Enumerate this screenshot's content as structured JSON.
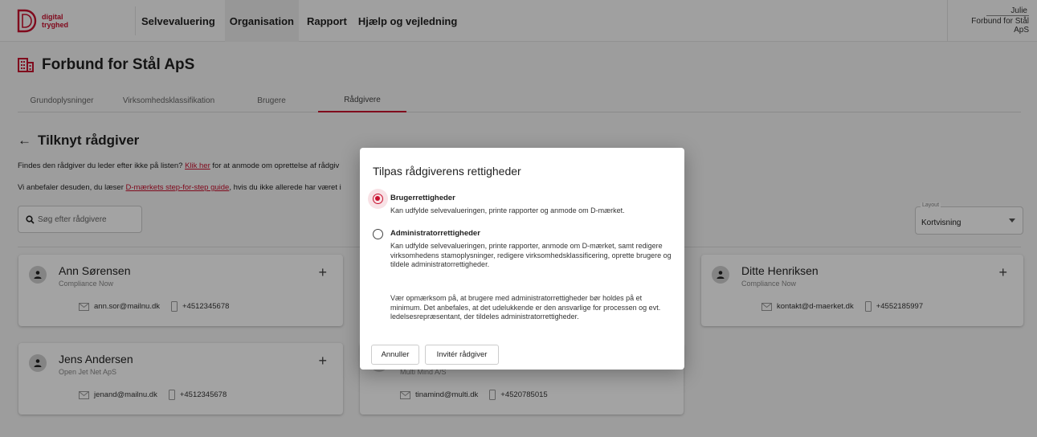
{
  "brand": {
    "line1": "digital",
    "line2": "tryghed",
    "color": "#c8102e"
  },
  "nav": {
    "items": [
      {
        "label": "Selvevaluering"
      },
      {
        "label": "Organisation"
      },
      {
        "label": "Rapport"
      },
      {
        "label": "Hjælp og vejledning"
      }
    ]
  },
  "user": {
    "name": "Julie",
    "org_line1": "Forbund for Stål",
    "org_line2": "ApS"
  },
  "org": {
    "title": "Forbund for Stål ApS"
  },
  "tabs": [
    {
      "label": "Grundoplysninger"
    },
    {
      "label": "Virksomhedsklassifikation"
    },
    {
      "label": "Brugere"
    },
    {
      "label": "Rådgivere"
    }
  ],
  "section": {
    "back_arrow": "←",
    "title": "Tilknyt rådgiver",
    "info1_pre": "Findes den rådgiver du leder efter ikke på listen? ",
    "info1_link": "Klik her",
    "info1_post": " for at anmode om oprettelse af rådgiv",
    "info2_pre": "Vi anbefaler desuden, du læser ",
    "info2_link": "D-mærkets step-for-step guide",
    "info2_post": ", hvis du ikke allerede har været i"
  },
  "search": {
    "placeholder": "Søg efter rådgivere"
  },
  "layout": {
    "label": "Layout",
    "value": "Kortvisning"
  },
  "cards": [
    {
      "name": "Ann Sørensen",
      "company": "Compliance Now",
      "email": "ann.sor@mailnu.dk",
      "phone": "+4512345678"
    },
    {
      "name": "Ditte Henriksen",
      "company": "Compliance Now",
      "email": "kontakt@d-maerket.dk",
      "phone": "+4552185997"
    },
    {
      "name": "Jens Andersen",
      "company": "Open Jet Net ApS",
      "email": "jenand@mailnu.dk",
      "phone": "+4512345678"
    },
    {
      "name": "",
      "company": "Multi Mind A/S",
      "email": "tinamind@multi.dk",
      "phone": "+4520785015"
    }
  ],
  "dialog": {
    "title": "Tilpas rådgiverens rettigheder",
    "option1_title": "Brugerrettigheder",
    "option1_desc": "Kan udfylde selvevalueringen, printe rapporter og anmode om D-mærket.",
    "option2_title": "Administratorrettigheder",
    "option2_desc": "Kan udfylde selvevalueringen, printe rapporter, anmode om D-mærket, samt redigere virksomhedens stamoplysninger, redigere virksomhedsklassificering, oprette brugere og tildele administratorrettigheder.",
    "note": "Vær opmærksom på, at brugere med administratorrettigheder bør holdes på et minimum. Det anbefales, at det udelukkende er den ansvarlige for processen og evt. ledelsesrepræsentant, der tildeles administratorrettigheder.",
    "cancel_label": "Annuller",
    "invite_label": "Invitér rådgiver"
  }
}
